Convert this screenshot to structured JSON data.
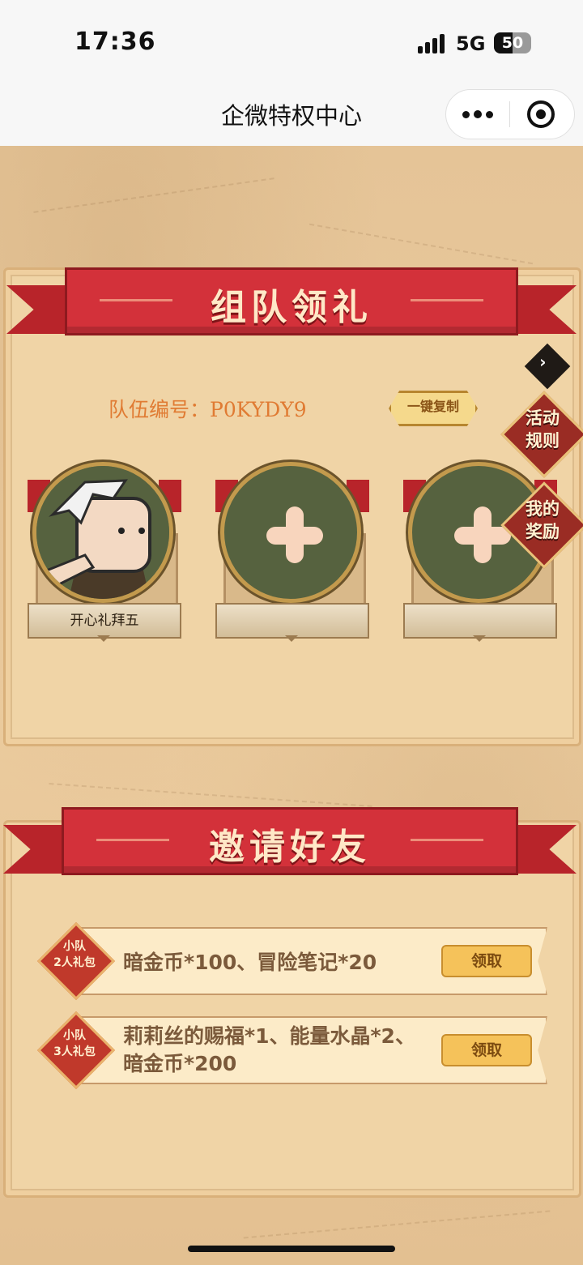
{
  "status_bar": {
    "time": "17:36",
    "network": "5G",
    "battery": "50",
    "battery_level": 0.5
  },
  "nav": {
    "title": "企微特权中心",
    "more_icon": "more-dots-icon",
    "close_icon": "target-icon"
  },
  "team_section": {
    "banner_title": "组队领礼",
    "team_id_label": "队伍编号：P0KYDY9",
    "copy_button": "一键复制",
    "members": [
      {
        "name": "开心礼拜五",
        "has_avatar": true
      },
      {
        "name": "",
        "has_avatar": false
      },
      {
        "name": "",
        "has_avatar": false
      }
    ]
  },
  "side_buttons": {
    "rules": "活动\n规则",
    "rewards": "我的\n奖励"
  },
  "invite_section": {
    "banner_title": "邀请好友",
    "rewards": [
      {
        "badge": "小队\n2人礼包",
        "description": "暗金币*100、冒险笔记*20",
        "button": "领取"
      },
      {
        "badge": "小队\n3人礼包",
        "description": "莉莉丝的赐福*1、能量水晶*2、\n暗金币*200",
        "button": "领取"
      }
    ]
  },
  "colors": {
    "banner_red": "#d3313a",
    "parchment": "#f0d4a6",
    "team_id_orange": "#e07b33",
    "claim_gold": "#f5c25a"
  }
}
